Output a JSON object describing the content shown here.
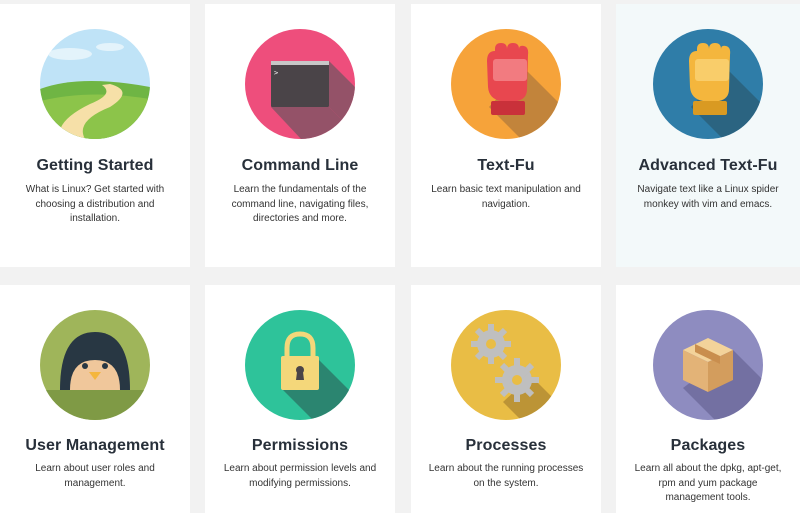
{
  "topics": [
    {
      "id": "getting-started",
      "title": "Getting Started",
      "description": "What is Linux? Get started with choosing a distribution and installation.",
      "icon": "landscape-icon",
      "color": "#b9e0f5"
    },
    {
      "id": "command-line",
      "title": "Command Line",
      "description": "Learn the fundamentals of the command line, navigating files, directories and more.",
      "icon": "terminal-icon",
      "color": "#ee4e7c"
    },
    {
      "id": "text-fu",
      "title": "Text-Fu",
      "description": "Learn basic text manipulation and navigation.",
      "icon": "glove-icon",
      "color": "#f6a33a"
    },
    {
      "id": "advanced-text-fu",
      "title": "Advanced Text-Fu",
      "description": "Navigate text like a Linux spider monkey with vim and emacs.",
      "icon": "gold-glove-icon",
      "color": "#2f7da8"
    },
    {
      "id": "user-management",
      "title": "User Management",
      "description": "Learn about user roles and management.",
      "icon": "penguin-icon",
      "color": "#9fb55a"
    },
    {
      "id": "permissions",
      "title": "Permissions",
      "description": "Learn about permission levels and modifying permissions.",
      "icon": "padlock-icon",
      "color": "#2ec39a"
    },
    {
      "id": "processes",
      "title": "Processes",
      "description": "Learn about the running processes on the system.",
      "icon": "gears-icon",
      "color": "#e9bd45"
    },
    {
      "id": "packages",
      "title": "Packages",
      "description": "Learn all about the dpkg, apt-get, rpm and yum package management tools.",
      "icon": "package-box-icon",
      "color": "#8e8cc0"
    }
  ]
}
